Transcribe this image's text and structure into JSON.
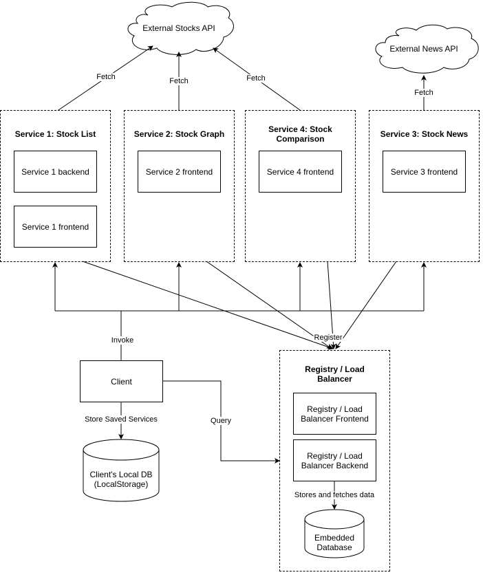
{
  "clouds": {
    "stocks_api": "External Stocks API",
    "news_api": "External News API"
  },
  "services": [
    {
      "title": "Service 1: Stock List",
      "components": [
        "Service 1 backend",
        "Service 1 frontend"
      ]
    },
    {
      "title": "Service 2: Stock Graph",
      "components": [
        "Service 2 frontend"
      ]
    },
    {
      "title": "Service 4: Stock Comparison",
      "components": [
        "Service 4 frontend"
      ]
    },
    {
      "title": "Service 3: Stock News",
      "components": [
        "Service 3 frontend"
      ]
    }
  ],
  "client": {
    "label": "Client",
    "local_db": "Client's Local DB (LocalStorage)"
  },
  "registry": {
    "title": "Registry / Load Balancer",
    "frontend": "Registry / Load Balancer Frontend",
    "backend": "Registry / Load Balancer Backend",
    "database": "Embedded Database"
  },
  "edge_labels": {
    "fetch": "Fetch",
    "invoke": "Invoke",
    "register": "Register",
    "store_saved": "Store Saved Services",
    "query": "Query",
    "stores_fetches": "Stores and fetches data"
  }
}
